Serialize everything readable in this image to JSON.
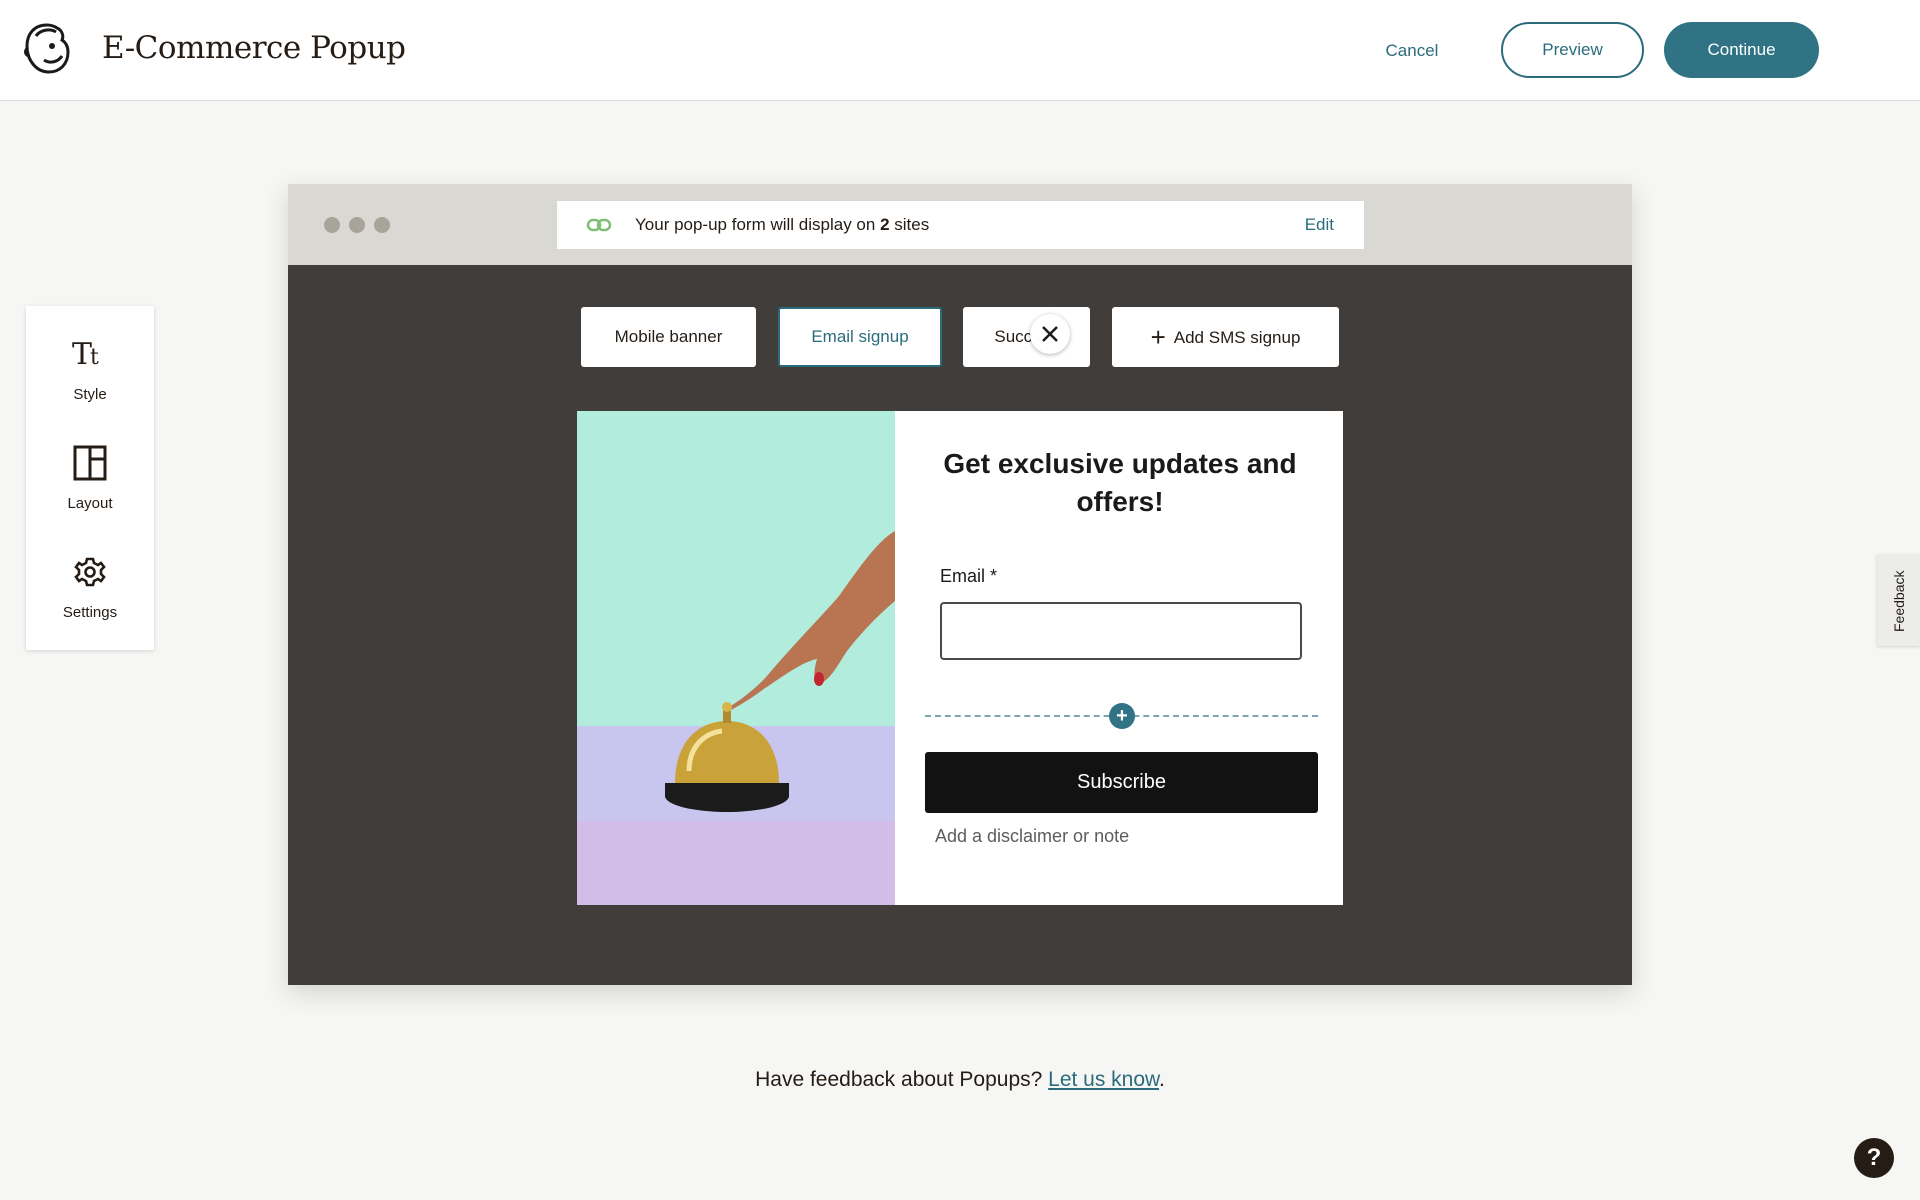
{
  "header": {
    "logo_icon": "mailchimp-freddie-logo-icon",
    "title": "E-Commerce Popup",
    "cancel_label": "Cancel",
    "preview_label": "Preview",
    "continue_label": "Continue",
    "accent_color": "#2f7385"
  },
  "tools": [
    {
      "label": "Style",
      "icon": "typography-icon"
    },
    {
      "label": "Layout",
      "icon": "layout-icon"
    },
    {
      "label": "Settings",
      "icon": "gear-icon"
    }
  ],
  "browser": {
    "url_notice_prefix": "Your pop-up form will display on ",
    "url_notice_count": "2",
    "url_notice_suffix": " sites",
    "edit_label": "Edit"
  },
  "form_tabs": [
    {
      "label": "Mobile banner",
      "active": false
    },
    {
      "label": "Email signup",
      "active": true
    },
    {
      "label": "Success",
      "active": false
    },
    {
      "label": "Add SMS signup",
      "active": false,
      "icon": "plus-icon"
    }
  ],
  "popup": {
    "title": "Get exclusive updates and offers!",
    "email_label": "Email *",
    "email_value": "",
    "subscribe_label": "Subscribe",
    "disclaimer_placeholder": "Add a disclaimer or note",
    "close_icon": "close-icon",
    "add_block_icon": "plus-circle-icon"
  },
  "footer": {
    "feedback_prefix": "Have feedback about Popups? ",
    "feedback_link": "Let us know",
    "feedback_suffix": "."
  },
  "side_feedback_label": "Feedback",
  "help_label": "?"
}
